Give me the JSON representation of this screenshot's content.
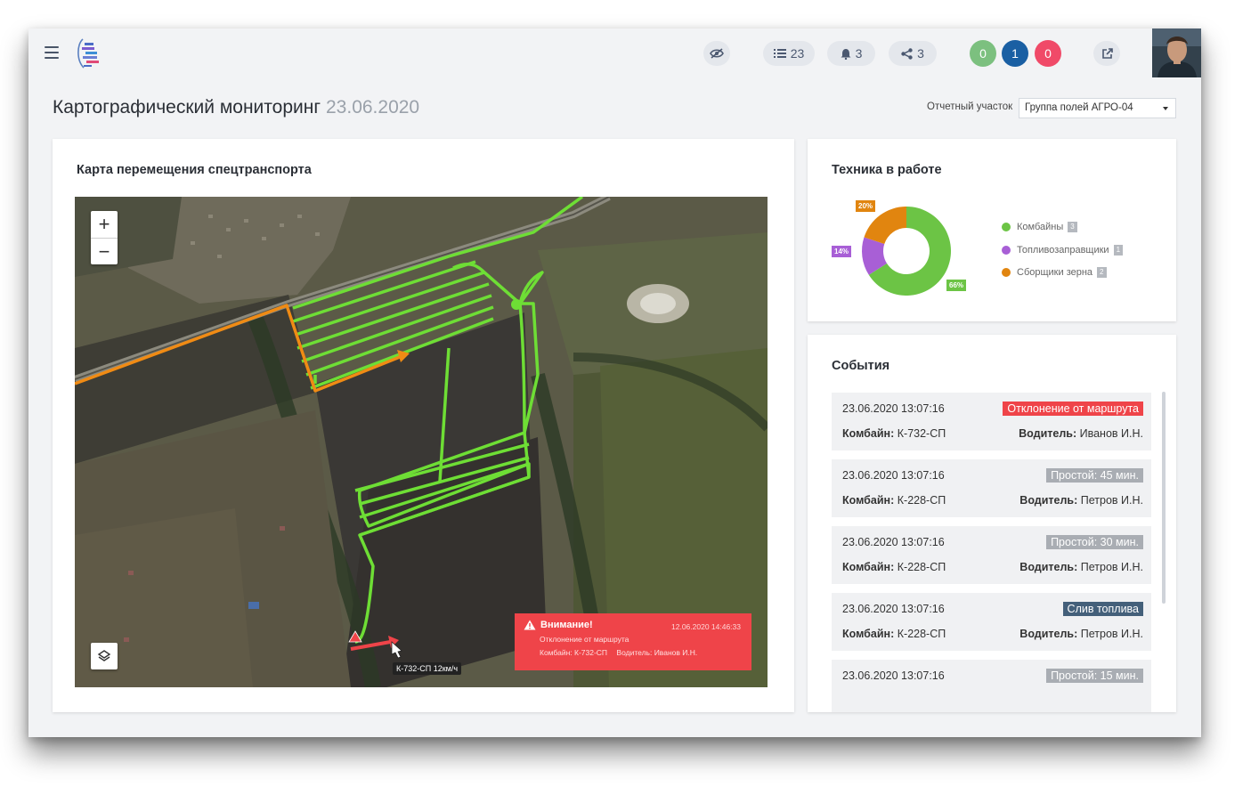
{
  "header": {
    "hidden_count": "",
    "list_count": "23",
    "notifications_count": "3",
    "share_count": "3",
    "status_counts": [
      {
        "value": "0",
        "color": "#7cc07f"
      },
      {
        "value": "1",
        "color": "#1a5fa3"
      },
      {
        "value": "0",
        "color": "#f04a68"
      }
    ]
  },
  "page": {
    "title": "Картографический мониторинг",
    "date": "23.06.2020",
    "area_label": "Отчетный участок",
    "area_value": "Группа полей АГРО-04"
  },
  "map_card": {
    "title": "Карта перемещения спецтранспорта",
    "vehicle_label": "К-732-СП 12км/ч",
    "alert": {
      "title": "Внимание!",
      "time": "12.06.2020 14:46:33",
      "message": "Отклонение от маршрута",
      "vehicle": "Комбайн: К-732-СП",
      "driver": "Водитель: Иванов И.Н."
    }
  },
  "equipment_card": {
    "title": "Техника в работе",
    "legend": [
      {
        "label": "Комбайны",
        "count": "3",
        "color": "#6cc445"
      },
      {
        "label": "Топливозаправщики",
        "count": "1",
        "color": "#a85fd6"
      },
      {
        "label": "Сборщики зерна",
        "count": "2",
        "color": "#e1850f"
      }
    ],
    "percent_labels": {
      "green": "66%",
      "purple": "14%",
      "orange": "20%"
    }
  },
  "chart_data": {
    "type": "pie",
    "title": "Техника в работе",
    "categories": [
      "Комбайны",
      "Топливозаправщики",
      "Сборщики зерна"
    ],
    "values": [
      66,
      14,
      20
    ],
    "counts": [
      3,
      1,
      2
    ],
    "colors": [
      "#6cc445",
      "#a85fd6",
      "#e1850f"
    ]
  },
  "events_card": {
    "title": "События",
    "vehicle_label": "Комбайн:",
    "driver_label": "Водитель:",
    "items": [
      {
        "time": "23.06.2020 13:07:16",
        "badge": "Отклонение от маршрута",
        "badge_color": "#ef4449",
        "vehicle": "К-732-СП",
        "driver": "Иванов И.Н."
      },
      {
        "time": "23.06.2020 13:07:16",
        "badge": "Простой: 45 мин.",
        "badge_color": "#a9adb3",
        "vehicle": "К-228-СП",
        "driver": "Петров И.Н."
      },
      {
        "time": "23.06.2020 13:07:16",
        "badge": "Простой: 30 мин.",
        "badge_color": "#a9adb3",
        "vehicle": "К-228-СП",
        "driver": "Петров И.Н."
      },
      {
        "time": "23.06.2020 13:07:16",
        "badge": "Слив топлива",
        "badge_color": "#44607a",
        "vehicle": "К-228-СП",
        "driver": "Петров И.Н."
      },
      {
        "time": "23.06.2020 13:07:16",
        "badge": "Простой: 15 мин.",
        "badge_color": "#a9adb3",
        "vehicle": "",
        "driver": ""
      }
    ]
  }
}
